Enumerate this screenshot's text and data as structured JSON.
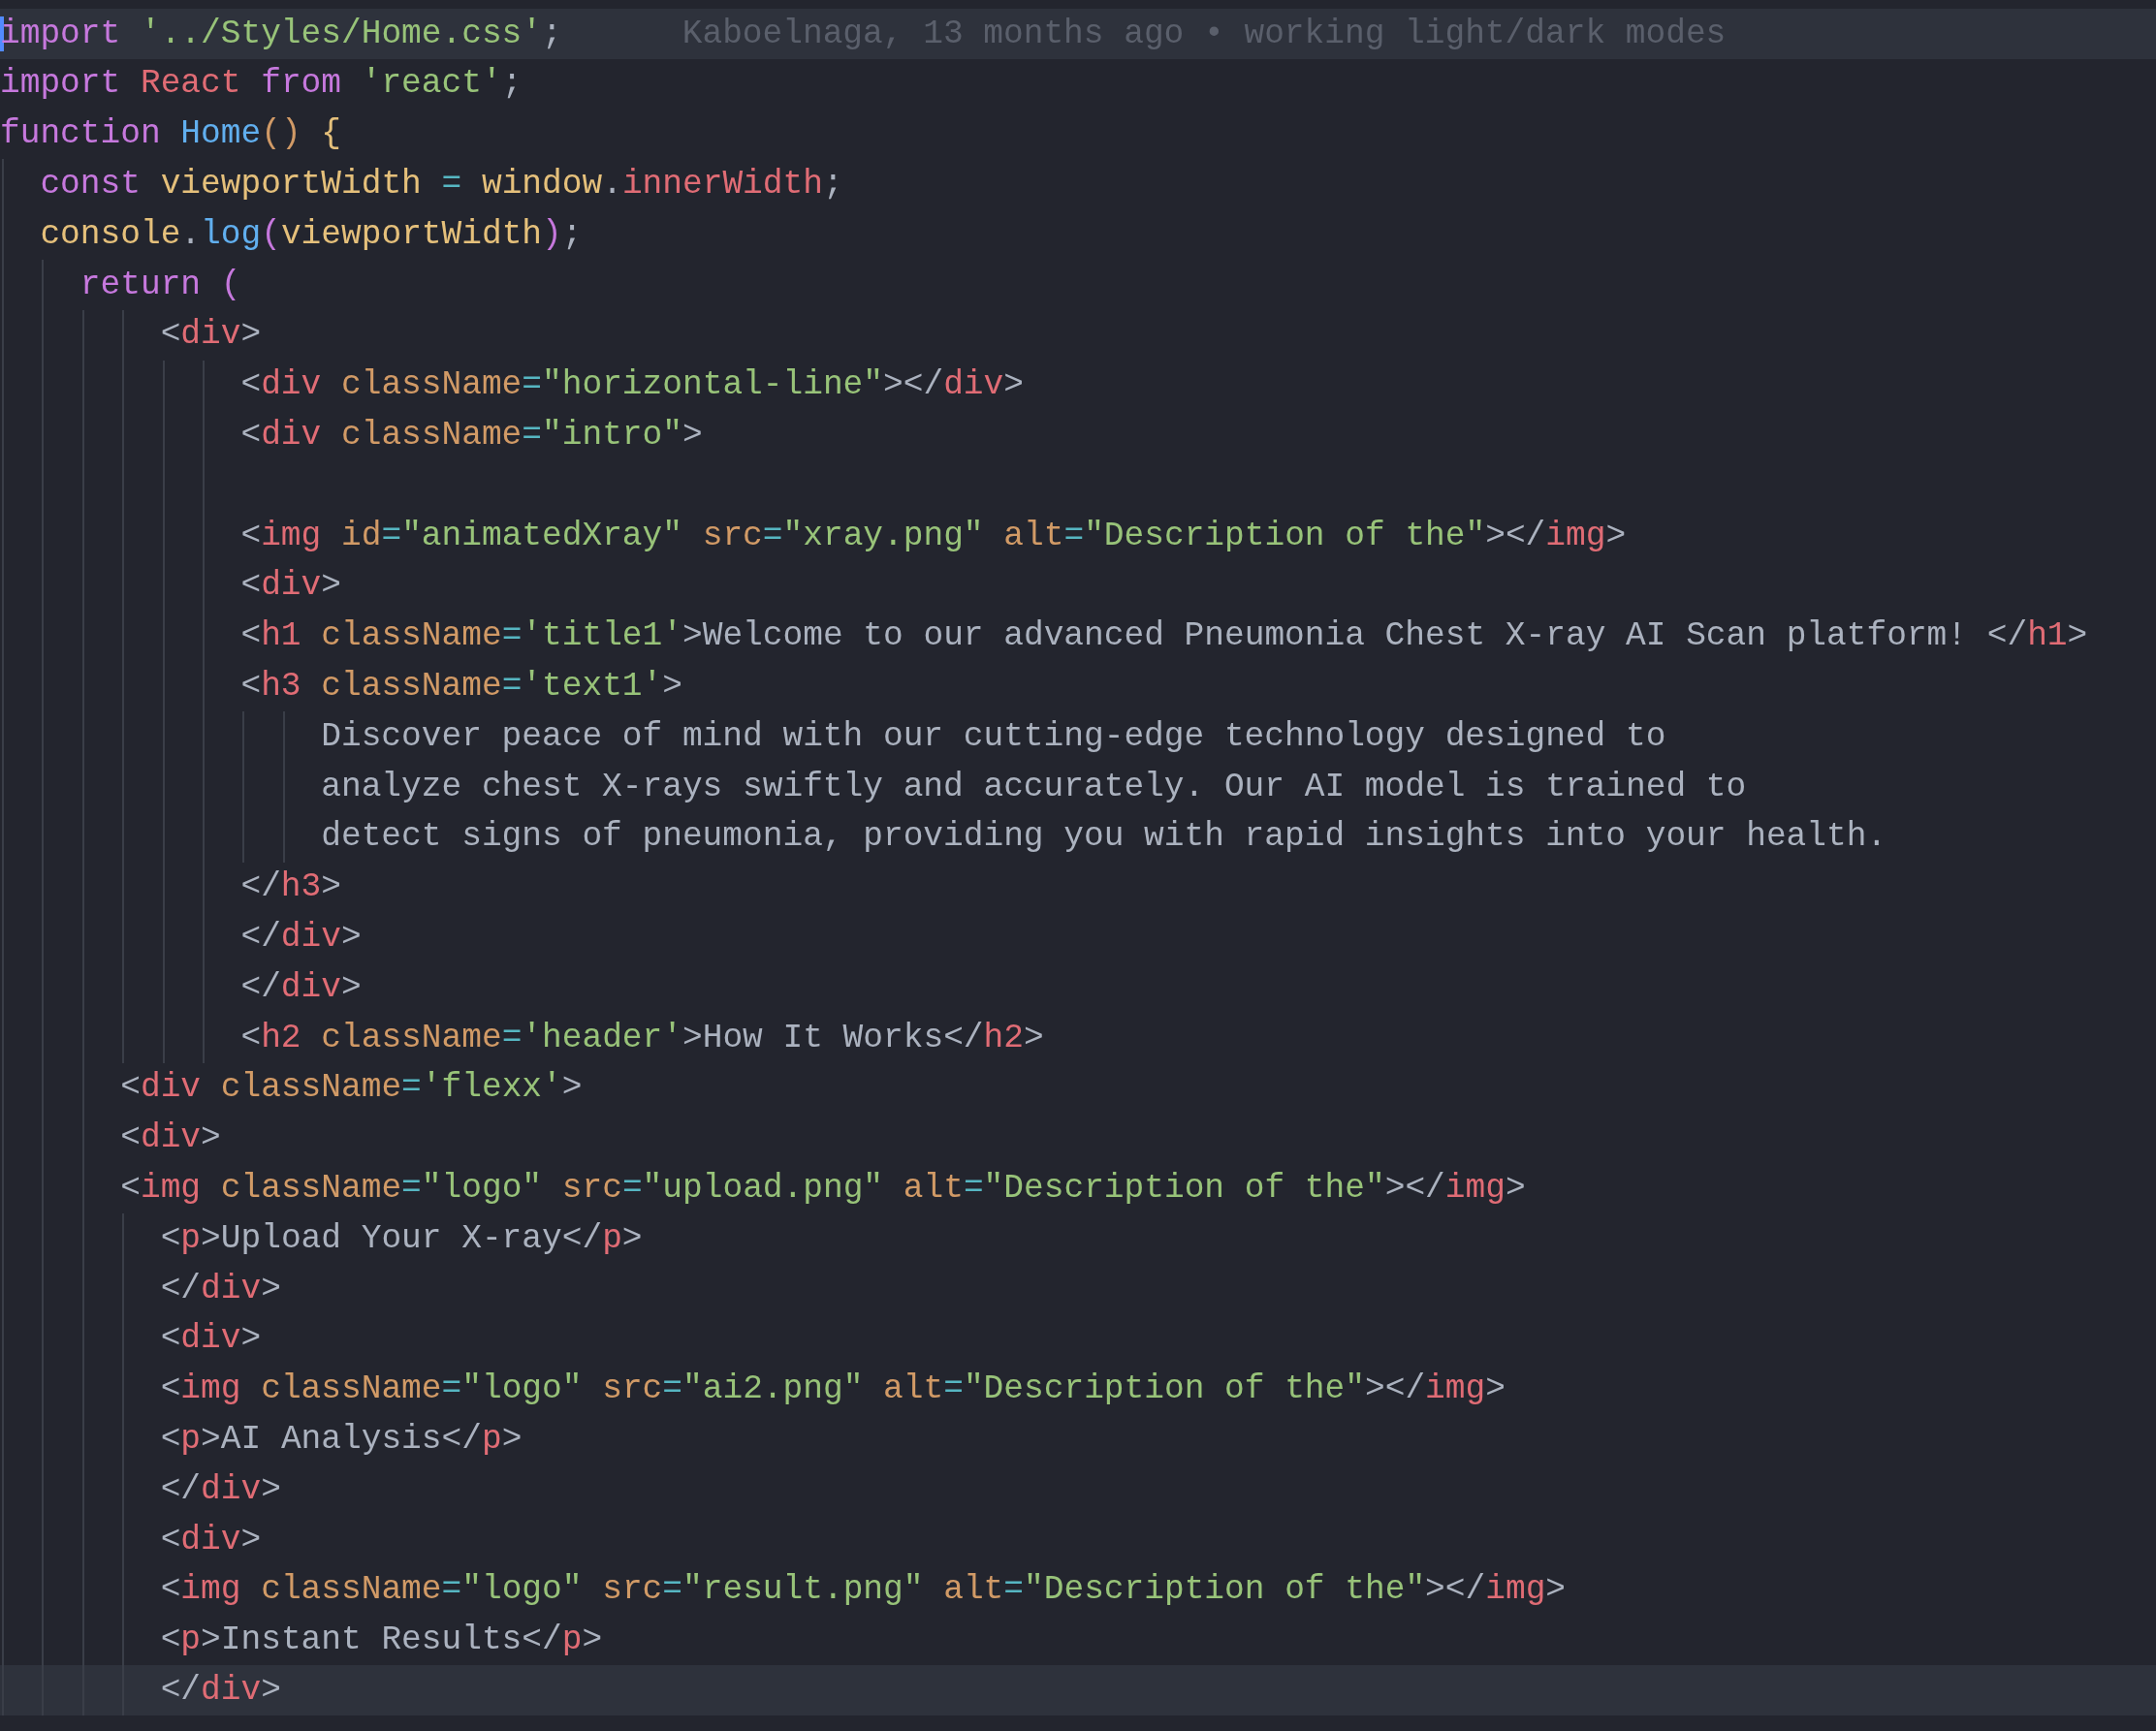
{
  "editor": {
    "lines": [
      {
        "highlighted": true,
        "cursor": true,
        "tokens": [
          {
            "kind": "kw",
            "text": "import "
          },
          {
            "kind": "str",
            "text": "'../Styles/Home.css'"
          },
          {
            "kind": "text",
            "text": ";"
          }
        ],
        "blame": "Kaboelnaga, 13 months ago • working light/dark modes"
      },
      {
        "highlighted": false,
        "cursor": false,
        "tokens": [
          {
            "kind": "kw",
            "text": "import "
          },
          {
            "kind": "name",
            "text": "React "
          },
          {
            "kind": "kw",
            "text": "from "
          },
          {
            "kind": "str",
            "text": "'react'"
          },
          {
            "kind": "text",
            "text": ";"
          }
        ]
      },
      {
        "highlighted": false,
        "cursor": false,
        "tokens": [
          {
            "kind": "kw",
            "text": "function "
          },
          {
            "kind": "fn",
            "text": "Home"
          },
          {
            "kind": "bracket",
            "text": "() "
          },
          {
            "kind": "var",
            "text": "{"
          }
        ]
      },
      {
        "highlighted": false,
        "cursor": false,
        "tokens": [
          {
            "kind": "kw",
            "text": "  const "
          },
          {
            "kind": "var",
            "text": "viewportWidth "
          },
          {
            "kind": "op",
            "text": "= "
          },
          {
            "kind": "var",
            "text": "window"
          },
          {
            "kind": "text",
            "text": "."
          },
          {
            "kind": "name",
            "text": "innerWidth"
          },
          {
            "kind": "text",
            "text": ";"
          }
        ]
      },
      {
        "highlighted": false,
        "cursor": false,
        "tokens": [
          {
            "kind": "var",
            "text": "  console"
          },
          {
            "kind": "text",
            "text": "."
          },
          {
            "kind": "fn",
            "text": "log"
          },
          {
            "kind": "kw",
            "text": "("
          },
          {
            "kind": "var",
            "text": "viewportWidth"
          },
          {
            "kind": "kw",
            "text": ")"
          },
          {
            "kind": "text",
            "text": ";"
          }
        ]
      },
      {
        "highlighted": false,
        "cursor": false,
        "tokens": [
          {
            "kind": "kw",
            "text": "    return ("
          }
        ]
      },
      {
        "highlighted": false,
        "cursor": false,
        "tokens": [
          {
            "kind": "text",
            "text": "        <"
          },
          {
            "kind": "tag",
            "text": "div"
          },
          {
            "kind": "text",
            "text": ">"
          }
        ]
      },
      {
        "highlighted": false,
        "cursor": false,
        "tokens": [
          {
            "kind": "text",
            "text": "            <"
          },
          {
            "kind": "tag",
            "text": "div "
          },
          {
            "kind": "attr",
            "text": "className"
          },
          {
            "kind": "op",
            "text": "="
          },
          {
            "kind": "str",
            "text": "\"horizontal-line\""
          },
          {
            "kind": "text",
            "text": "></"
          },
          {
            "kind": "tag",
            "text": "div"
          },
          {
            "kind": "text",
            "text": ">"
          }
        ]
      },
      {
        "highlighted": false,
        "cursor": false,
        "tokens": [
          {
            "kind": "text",
            "text": "            <"
          },
          {
            "kind": "tag",
            "text": "div "
          },
          {
            "kind": "attr",
            "text": "className"
          },
          {
            "kind": "op",
            "text": "="
          },
          {
            "kind": "str",
            "text": "\"intro\""
          },
          {
            "kind": "text",
            "text": ">"
          }
        ]
      },
      {
        "highlighted": false,
        "cursor": false
      },
      {
        "highlighted": false,
        "cursor": false,
        "tokens": [
          {
            "kind": "text",
            "text": "            <"
          },
          {
            "kind": "tag",
            "text": "img "
          },
          {
            "kind": "attr",
            "text": "id"
          },
          {
            "kind": "op",
            "text": "="
          },
          {
            "kind": "str",
            "text": "\"animatedXray\" "
          },
          {
            "kind": "attr",
            "text": "src"
          },
          {
            "kind": "op",
            "text": "="
          },
          {
            "kind": "str",
            "text": "\"xray.png\" "
          },
          {
            "kind": "attr",
            "text": "alt"
          },
          {
            "kind": "op",
            "text": "="
          },
          {
            "kind": "str",
            "text": "\"Description of the\""
          },
          {
            "kind": "text",
            "text": "></"
          },
          {
            "kind": "tag",
            "text": "img"
          },
          {
            "kind": "text",
            "text": ">"
          }
        ]
      },
      {
        "highlighted": false,
        "cursor": false,
        "tokens": [
          {
            "kind": "text",
            "text": "            <"
          },
          {
            "kind": "tag",
            "text": "div"
          },
          {
            "kind": "text",
            "text": ">"
          }
        ]
      },
      {
        "highlighted": false,
        "cursor": false,
        "tokens": [
          {
            "kind": "text",
            "text": "            <"
          },
          {
            "kind": "tag",
            "text": "h1 "
          },
          {
            "kind": "attr",
            "text": "className"
          },
          {
            "kind": "op",
            "text": "="
          },
          {
            "kind": "str",
            "text": "'title1'"
          },
          {
            "kind": "text",
            "text": ">Welcome to our advanced Pneumonia Chest X-ray AI Scan platform! </"
          },
          {
            "kind": "tag",
            "text": "h1"
          },
          {
            "kind": "text",
            "text": ">"
          }
        ]
      },
      {
        "highlighted": false,
        "cursor": false,
        "tokens": [
          {
            "kind": "text",
            "text": "            <"
          },
          {
            "kind": "tag",
            "text": "h3 "
          },
          {
            "kind": "attr",
            "text": "className"
          },
          {
            "kind": "op",
            "text": "="
          },
          {
            "kind": "str",
            "text": "'text1'"
          },
          {
            "kind": "text",
            "text": ">"
          }
        ]
      },
      {
        "highlighted": false,
        "cursor": false,
        "tokens": [
          {
            "kind": "text",
            "text": "                Discover peace of mind with our cutting-edge technology designed to"
          }
        ]
      },
      {
        "highlighted": false,
        "cursor": false,
        "tokens": [
          {
            "kind": "text",
            "text": "                analyze chest X-rays swiftly and accurately. Our AI model is trained to"
          }
        ]
      },
      {
        "highlighted": false,
        "cursor": false,
        "tokens": [
          {
            "kind": "text",
            "text": "                detect signs of pneumonia, providing you with rapid insights into your health."
          }
        ]
      },
      {
        "highlighted": false,
        "cursor": false,
        "tokens": [
          {
            "kind": "text",
            "text": "            </"
          },
          {
            "kind": "tag",
            "text": "h3"
          },
          {
            "kind": "text",
            "text": ">"
          }
        ]
      },
      {
        "highlighted": false,
        "cursor": false,
        "tokens": [
          {
            "kind": "text",
            "text": "            </"
          },
          {
            "kind": "tag",
            "text": "div"
          },
          {
            "kind": "text",
            "text": ">"
          }
        ]
      },
      {
        "highlighted": false,
        "cursor": false,
        "tokens": [
          {
            "kind": "text",
            "text": "            </"
          },
          {
            "kind": "tag",
            "text": "div"
          },
          {
            "kind": "text",
            "text": ">"
          }
        ]
      },
      {
        "highlighted": false,
        "cursor": false,
        "tokens": [
          {
            "kind": "text",
            "text": "            <"
          },
          {
            "kind": "tag",
            "text": "h2 "
          },
          {
            "kind": "attr",
            "text": "className"
          },
          {
            "kind": "op",
            "text": "="
          },
          {
            "kind": "str",
            "text": "'header'"
          },
          {
            "kind": "text",
            "text": ">How It Works</"
          },
          {
            "kind": "tag",
            "text": "h2"
          },
          {
            "kind": "text",
            "text": ">"
          }
        ]
      },
      {
        "highlighted": false,
        "cursor": false,
        "tokens": [
          {
            "kind": "text",
            "text": "      <"
          },
          {
            "kind": "tag",
            "text": "div "
          },
          {
            "kind": "attr",
            "text": "className"
          },
          {
            "kind": "op",
            "text": "="
          },
          {
            "kind": "str",
            "text": "'flexx'"
          },
          {
            "kind": "text",
            "text": ">"
          }
        ]
      },
      {
        "highlighted": false,
        "cursor": false,
        "tokens": [
          {
            "kind": "text",
            "text": "      <"
          },
          {
            "kind": "tag",
            "text": "div"
          },
          {
            "kind": "text",
            "text": ">"
          }
        ]
      },
      {
        "highlighted": false,
        "cursor": false,
        "tokens": [
          {
            "kind": "text",
            "text": "      <"
          },
          {
            "kind": "tag",
            "text": "img "
          },
          {
            "kind": "attr",
            "text": "className"
          },
          {
            "kind": "op",
            "text": "="
          },
          {
            "kind": "str",
            "text": "\"logo\" "
          },
          {
            "kind": "attr",
            "text": "src"
          },
          {
            "kind": "op",
            "text": "="
          },
          {
            "kind": "str",
            "text": "\"upload.png\" "
          },
          {
            "kind": "attr",
            "text": "alt"
          },
          {
            "kind": "op",
            "text": "="
          },
          {
            "kind": "str",
            "text": "\"Description of the\""
          },
          {
            "kind": "text",
            "text": "></"
          },
          {
            "kind": "tag",
            "text": "img"
          },
          {
            "kind": "text",
            "text": ">"
          }
        ]
      },
      {
        "highlighted": false,
        "cursor": false,
        "tokens": [
          {
            "kind": "text",
            "text": "        <"
          },
          {
            "kind": "tag",
            "text": "p"
          },
          {
            "kind": "text",
            "text": ">Upload Your X-ray</"
          },
          {
            "kind": "tag",
            "text": "p"
          },
          {
            "kind": "text",
            "text": ">"
          }
        ]
      },
      {
        "highlighted": false,
        "cursor": false,
        "tokens": [
          {
            "kind": "text",
            "text": "        </"
          },
          {
            "kind": "tag",
            "text": "div"
          },
          {
            "kind": "text",
            "text": ">"
          }
        ]
      },
      {
        "highlighted": false,
        "cursor": false,
        "tokens": [
          {
            "kind": "text",
            "text": "        <"
          },
          {
            "kind": "tag",
            "text": "div"
          },
          {
            "kind": "text",
            "text": ">"
          }
        ]
      },
      {
        "highlighted": false,
        "cursor": false,
        "tokens": [
          {
            "kind": "text",
            "text": "        <"
          },
          {
            "kind": "tag",
            "text": "img "
          },
          {
            "kind": "attr",
            "text": "className"
          },
          {
            "kind": "op",
            "text": "="
          },
          {
            "kind": "str",
            "text": "\"logo\" "
          },
          {
            "kind": "attr",
            "text": "src"
          },
          {
            "kind": "op",
            "text": "="
          },
          {
            "kind": "str",
            "text": "\"ai2.png\" "
          },
          {
            "kind": "attr",
            "text": "alt"
          },
          {
            "kind": "op",
            "text": "="
          },
          {
            "kind": "str",
            "text": "\"Description of the\""
          },
          {
            "kind": "text",
            "text": "></"
          },
          {
            "kind": "tag",
            "text": "img"
          },
          {
            "kind": "text",
            "text": ">"
          }
        ]
      },
      {
        "highlighted": false,
        "cursor": false,
        "tokens": [
          {
            "kind": "text",
            "text": "        <"
          },
          {
            "kind": "tag",
            "text": "p"
          },
          {
            "kind": "text",
            "text": ">AI Analysis</"
          },
          {
            "kind": "tag",
            "text": "p"
          },
          {
            "kind": "text",
            "text": ">"
          }
        ]
      },
      {
        "highlighted": false,
        "cursor": false,
        "tokens": [
          {
            "kind": "text",
            "text": "        </"
          },
          {
            "kind": "tag",
            "text": "div"
          },
          {
            "kind": "text",
            "text": ">"
          }
        ]
      },
      {
        "highlighted": false,
        "cursor": false,
        "tokens": [
          {
            "kind": "text",
            "text": "        <"
          },
          {
            "kind": "tag",
            "text": "div"
          },
          {
            "kind": "text",
            "text": ">"
          }
        ]
      },
      {
        "highlighted": false,
        "cursor": false,
        "tokens": [
          {
            "kind": "text",
            "text": "        <"
          },
          {
            "kind": "tag",
            "text": "img "
          },
          {
            "kind": "attr",
            "text": "className"
          },
          {
            "kind": "op",
            "text": "="
          },
          {
            "kind": "str",
            "text": "\"logo\" "
          },
          {
            "kind": "attr",
            "text": "src"
          },
          {
            "kind": "op",
            "text": "="
          },
          {
            "kind": "str",
            "text": "\"result.png\" "
          },
          {
            "kind": "attr",
            "text": "alt"
          },
          {
            "kind": "op",
            "text": "="
          },
          {
            "kind": "str",
            "text": "\"Description of the\""
          },
          {
            "kind": "text",
            "text": "></"
          },
          {
            "kind": "tag",
            "text": "img"
          },
          {
            "kind": "text",
            "text": ">"
          }
        ]
      },
      {
        "highlighted": false,
        "cursor": false,
        "tokens": [
          {
            "kind": "text",
            "text": "        <"
          },
          {
            "kind": "tag",
            "text": "p"
          },
          {
            "kind": "text",
            "text": ">Instant Results</"
          },
          {
            "kind": "tag",
            "text": "p"
          },
          {
            "kind": "text",
            "text": ">"
          }
        ]
      },
      {
        "highlighted": true,
        "cursor": false,
        "tokens": [
          {
            "kind": "text",
            "text": "        </"
          },
          {
            "kind": "tag",
            "text": "div"
          },
          {
            "kind": "text",
            "text": ">"
          }
        ]
      }
    ]
  }
}
